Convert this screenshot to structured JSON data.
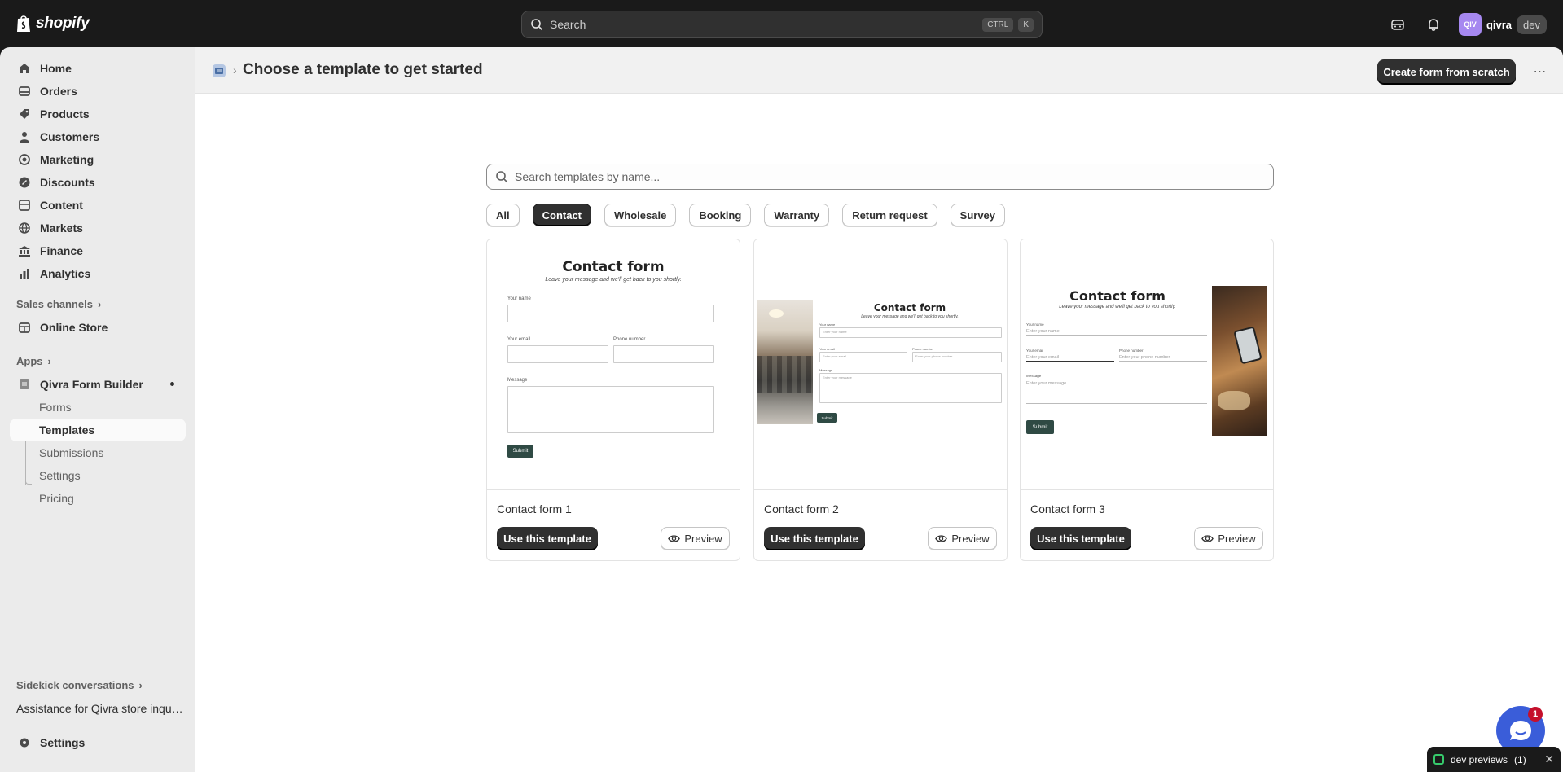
{
  "brand": {
    "name": "shopify"
  },
  "topbar": {
    "search_placeholder": "Search",
    "shortcut_keys": [
      "CTRL",
      "K"
    ],
    "account": {
      "initials": "QIV",
      "name": "qivra",
      "tag": "dev"
    }
  },
  "sidebar": {
    "nav": [
      {
        "label": "Home",
        "icon": "home-icon"
      },
      {
        "label": "Orders",
        "icon": "orders-icon"
      },
      {
        "label": "Products",
        "icon": "tag-icon"
      },
      {
        "label": "Customers",
        "icon": "person-icon"
      },
      {
        "label": "Marketing",
        "icon": "target-icon"
      },
      {
        "label": "Discounts",
        "icon": "discount-icon"
      },
      {
        "label": "Content",
        "icon": "content-icon"
      },
      {
        "label": "Markets",
        "icon": "globe-icon"
      },
      {
        "label": "Finance",
        "icon": "bank-icon"
      },
      {
        "label": "Analytics",
        "icon": "chart-icon"
      }
    ],
    "sales_channels": "Sales channels",
    "online_store": "Online Store",
    "apps": "Apps",
    "app_name": "Qivra Form Builder",
    "app_sub": [
      "Forms",
      "Templates",
      "Submissions",
      "Settings",
      "Pricing"
    ],
    "active_sub": "Templates",
    "sidekick": "Sidekick conversations",
    "sidekick_item": "Assistance for Qivra store inquiries",
    "settings": "Settings"
  },
  "page": {
    "title": "Choose a template to get started",
    "create_button": "Create form from scratch",
    "more": "⋯",
    "template_search_placeholder": "Search templates by name...",
    "filters": [
      "All",
      "Contact",
      "Wholesale",
      "Booking",
      "Warranty",
      "Return request",
      "Survey"
    ],
    "active_filter": "Contact",
    "cards": [
      {
        "title": "Contact form 1",
        "use": "Use this template",
        "preview": "Preview"
      },
      {
        "title": "Contact form 2",
        "use": "Use this template",
        "preview": "Preview"
      },
      {
        "title": "Contact form 3",
        "use": "Use this template",
        "preview": "Preview"
      }
    ]
  },
  "mini_form": {
    "title": "Contact form",
    "subtitle": "Leave your message and we'll get back to you shortly.",
    "name_label": "Your name",
    "email_label": "Your email",
    "phone_label": "Phone number",
    "message_label": "Message",
    "name_ph": "Enter your name",
    "email_ph": "Enter your email",
    "phone_ph": "Enter your phone number",
    "message_ph": "Enter your message",
    "submit": "Submit"
  },
  "floating": {
    "chat_badge": "1",
    "dev_previews": "dev previews",
    "dev_count": "(1)"
  },
  "colors": {
    "primary": "#303030",
    "avatar": "#a688f0",
    "chat": "#3a5dd9",
    "badge": "#c5102c",
    "submit": "#2f4a44"
  }
}
